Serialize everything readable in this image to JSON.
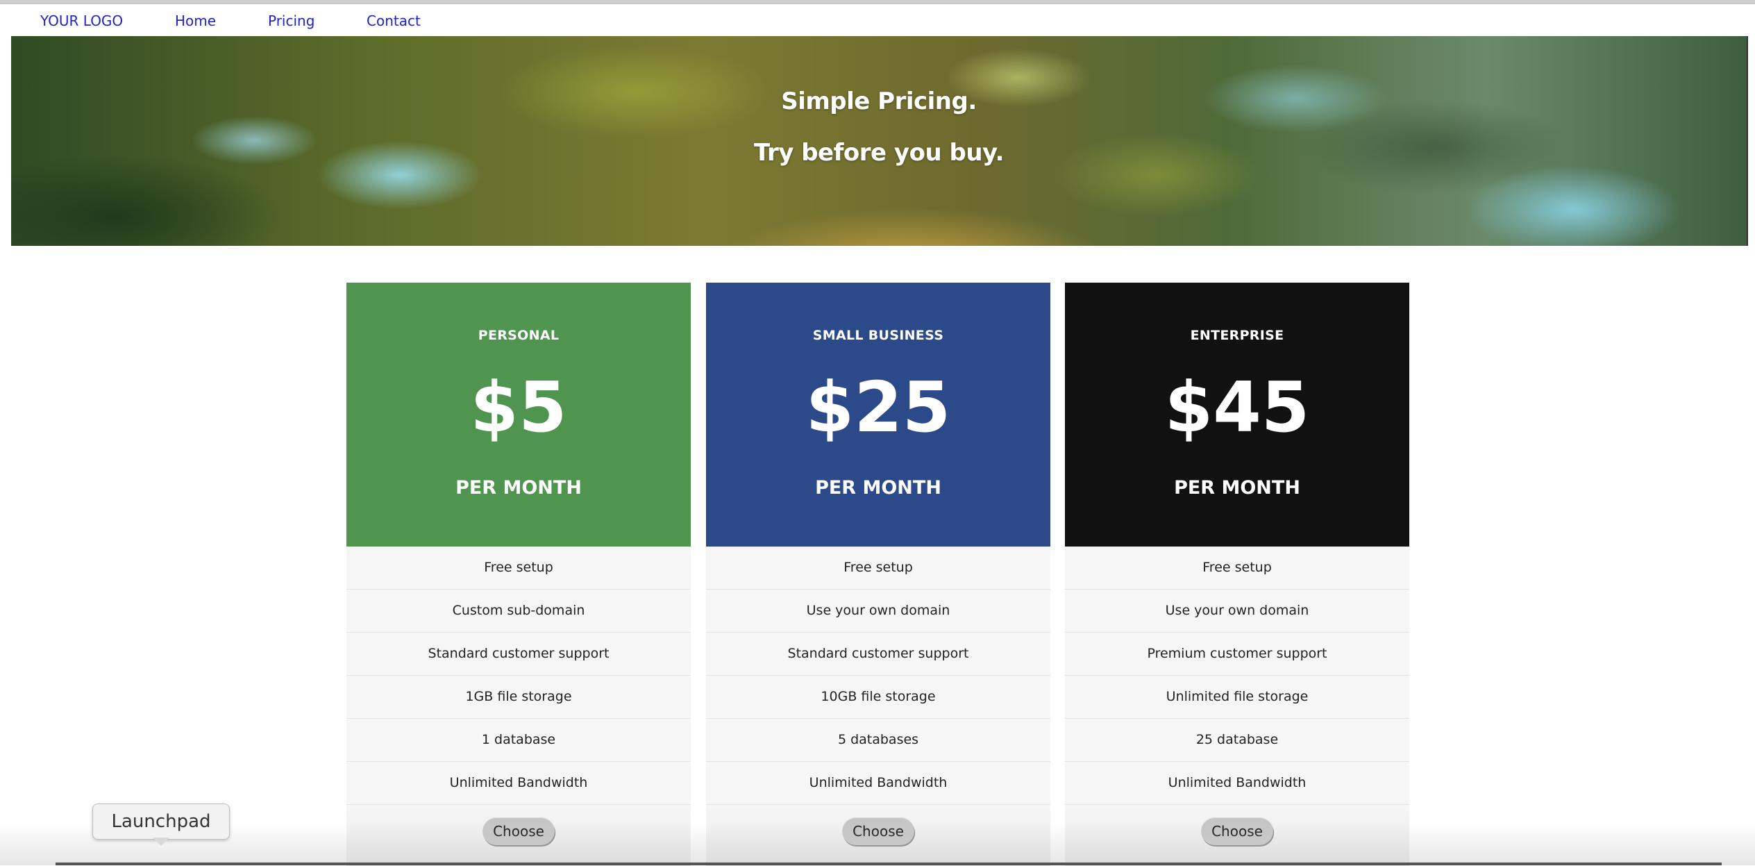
{
  "nav": {
    "logo": "YOUR LOGO",
    "items": [
      {
        "label": "Home"
      },
      {
        "label": "Pricing"
      },
      {
        "label": "Contact"
      }
    ],
    "link_color": "#2222cc"
  },
  "hero": {
    "title": "Simple Pricing.",
    "subtitle": "Try before you buy."
  },
  "plans": [
    {
      "name": "PERSONAL",
      "price": "$5",
      "period": "PER MONTH",
      "color": "#4f944f",
      "features": [
        "Free setup",
        "Custom sub-domain",
        "Standard customer support",
        "1GB file storage",
        "1 database",
        "Unlimited Bandwidth"
      ],
      "button": "Choose"
    },
    {
      "name": "SMALL BUSINESS",
      "price": "$25",
      "period": "PER MONTH",
      "color": "#2c4a8a",
      "features": [
        "Free setup",
        "Use your own domain",
        "Standard customer support",
        "10GB file storage",
        "5 databases",
        "Unlimited Bandwidth"
      ],
      "button": "Choose"
    },
    {
      "name": "ENTERPRISE",
      "price": "$45",
      "period": "PER MONTH",
      "color": "#111111",
      "features": [
        "Free setup",
        "Use your own domain",
        "Premium customer support",
        "Unlimited file storage",
        "25 database",
        "Unlimited Bandwidth"
      ],
      "button": "Choose"
    }
  ],
  "dock": {
    "tooltip": "Launchpad"
  }
}
